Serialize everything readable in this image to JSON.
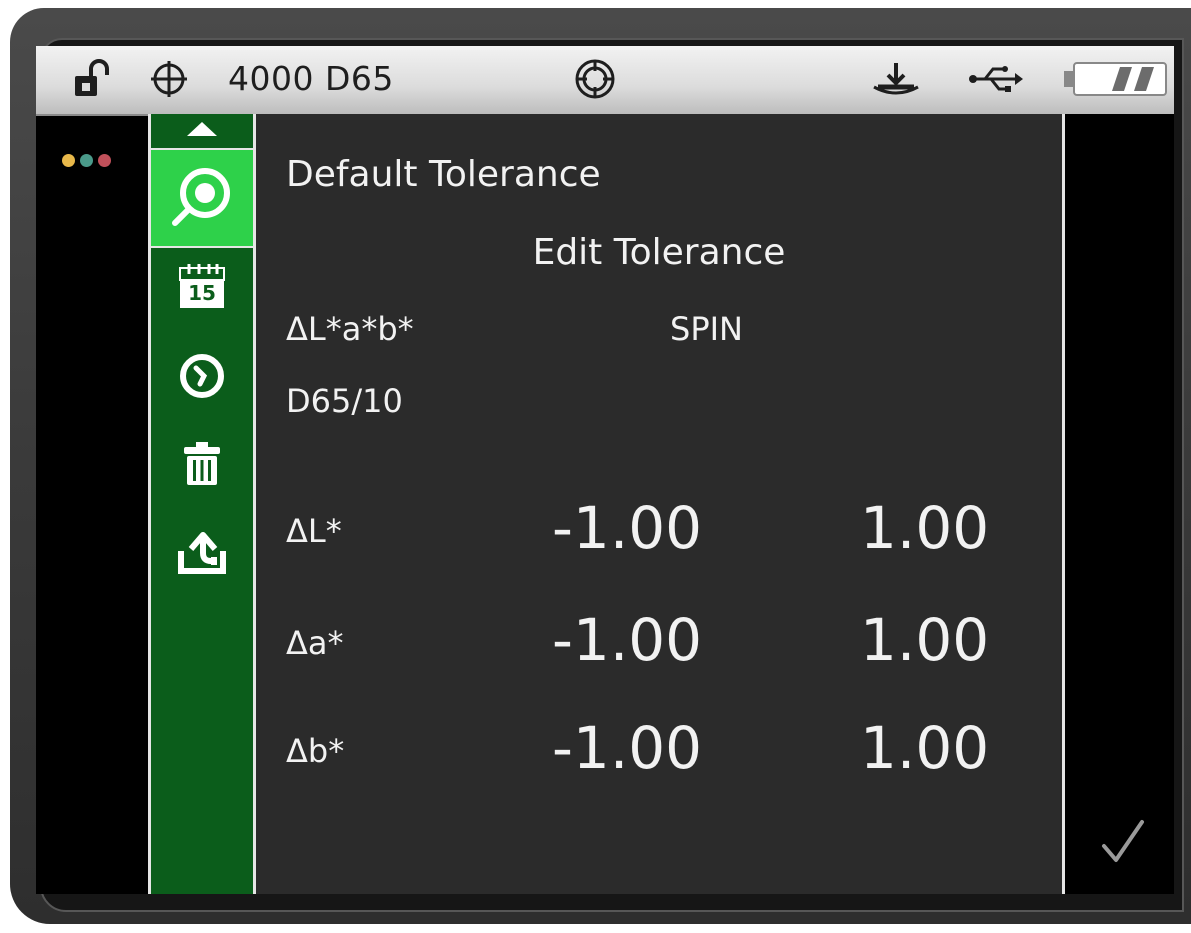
{
  "status_bar": {
    "lock_icon": "unlocked-padlock-icon",
    "target_icon": "crosshair-icon",
    "instrument_text": "4000 D65",
    "aperture_icon": "aperture-target-icon",
    "calibrate_icon": "calibration-tile-icon",
    "usb_icon": "usb-icon",
    "battery_icon": "battery-icon"
  },
  "indicator_dots": [
    "#e8b84a",
    "#4a9a8a",
    "#c0505a"
  ],
  "sidebar": {
    "scroll_up_icon": "triangle-up-icon",
    "items": [
      {
        "icon": "measure-target-icon",
        "selected": true
      },
      {
        "icon": "calendar-icon",
        "label": "15"
      },
      {
        "icon": "timer-icon"
      },
      {
        "icon": "trash-icon"
      },
      {
        "icon": "export-icon"
      }
    ]
  },
  "content": {
    "title": "Default Tolerance",
    "subtitle": "Edit Tolerance",
    "color_space": "ΔL*a*b*",
    "method": "SPIN",
    "illuminant": "D65/10",
    "rows": [
      {
        "label": "ΔL*",
        "low": "-1.00",
        "high": "1.00"
      },
      {
        "label": "Δa*",
        "low": "-1.00",
        "high": "1.00"
      },
      {
        "label": "Δb*",
        "low": "-1.00",
        "high": "1.00"
      }
    ]
  },
  "confirm_icon": "checkmark-icon",
  "colors": {
    "sidebar_green": "#0b5d1b",
    "selected_green": "#2ed14a",
    "panel_bg": "#2b2b2b"
  }
}
